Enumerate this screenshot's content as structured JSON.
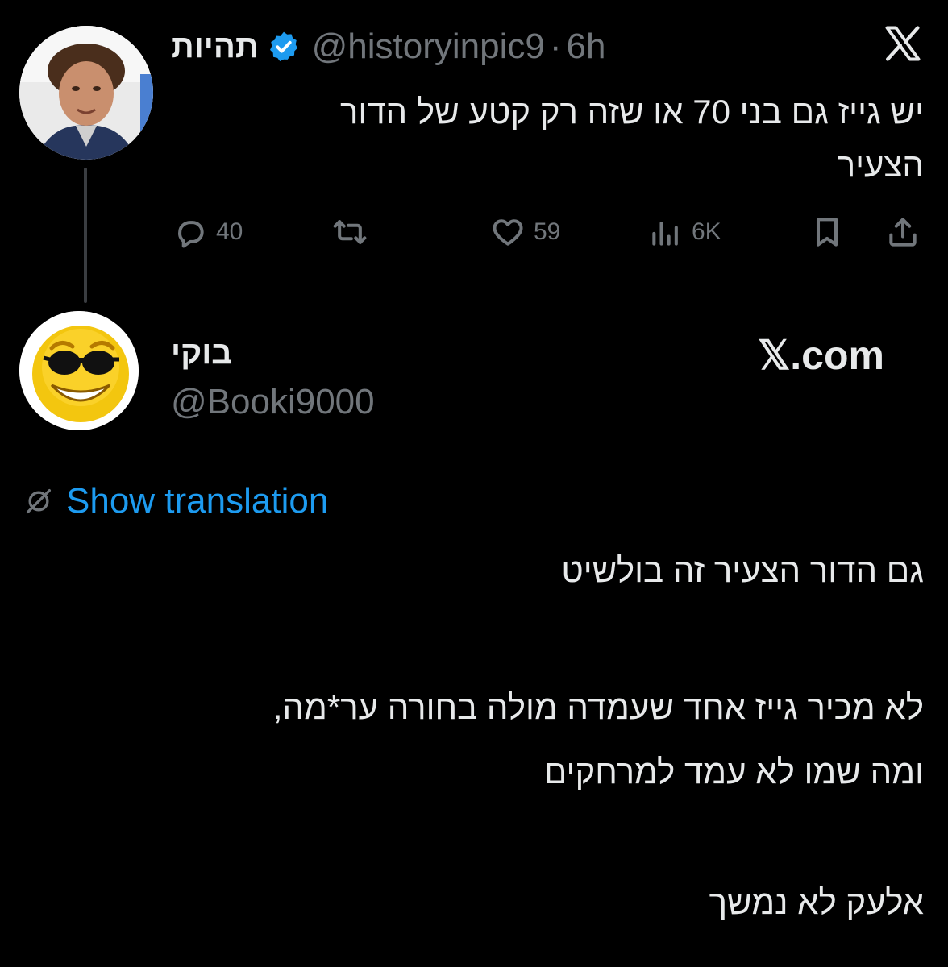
{
  "tweet1": {
    "name": "תהיות",
    "handle": "@historyinpic9",
    "separator": "·",
    "time": "6h",
    "text_line1": "יש גייז גם בני 70 או שזה רק קטע של הדור",
    "text_line2": "הצעיר",
    "actions": {
      "reply_count": "40",
      "like_count": "59",
      "views_count": "6K"
    }
  },
  "reply": {
    "name": "בוקי",
    "handle": "@Booki9000",
    "watermark": "𝕏.com",
    "show_translation": "Show translation",
    "lines": [
      "גם הדור הצעיר זה בולשיט",
      "לא מכיר גייז אחד שעמדה מולה בחורה ער*מה,",
      "ומה שמו לא עמד למרחקים",
      "אלעק לא נמשך"
    ]
  },
  "colors": {
    "background": "#000000",
    "text": "#e7e9ea",
    "secondary": "#71767b",
    "link": "#1d9bf0",
    "verified": "#1d9bf0"
  },
  "icons": [
    "x-logo-icon",
    "verified-badge-icon",
    "reply-icon",
    "retweet-icon",
    "like-icon",
    "views-icon",
    "bookmark-icon",
    "share-icon",
    "translate-icon"
  ]
}
